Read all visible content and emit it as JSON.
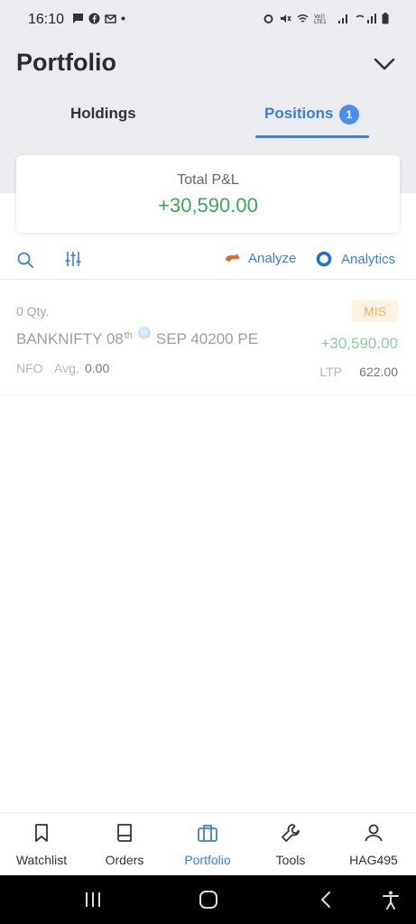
{
  "status_bar": {
    "time": "16:10"
  },
  "header": {
    "title": "Portfolio",
    "tabs": [
      {
        "label": "Holdings"
      },
      {
        "label": "Positions",
        "badge": "1"
      }
    ]
  },
  "pnl": {
    "label": "Total P&L",
    "value": "+30,590.00"
  },
  "toolbar": {
    "analyze_label": "Analyze",
    "analytics_label": "Analytics"
  },
  "positions": [
    {
      "qty": "0 Qty.",
      "product": "MIS",
      "symbol": "BANKNIFTY 08",
      "symbol_sup": "th",
      "weekly_badge": "W",
      "expiry_strike": "SEP 40200 PE",
      "pnl": "+30,590.00",
      "exchange": "NFO",
      "avg_label": "Avg.",
      "avg_value": "0.00",
      "ltp_label": "LTP",
      "ltp_value": "622.00"
    }
  ],
  "bottom_nav": {
    "items": [
      {
        "label": "Watchlist"
      },
      {
        "label": "Orders"
      },
      {
        "label": "Portfolio"
      },
      {
        "label": "Tools"
      },
      {
        "label": "HAG495"
      }
    ],
    "active": "Portfolio"
  },
  "colors": {
    "accent": "#3b7fd9",
    "profit": "#3ea559",
    "mis_badge": "#f3b65d"
  }
}
